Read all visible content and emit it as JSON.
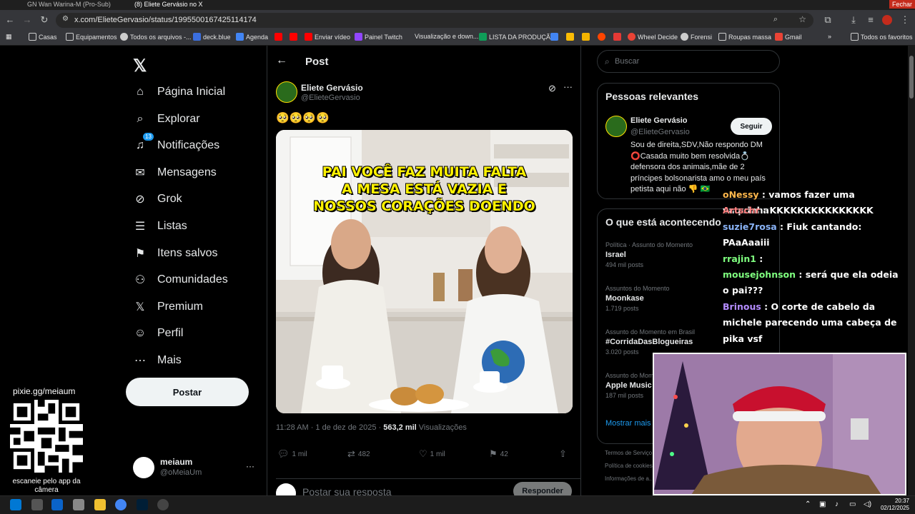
{
  "browser": {
    "tabs": [
      "GN Wan Warina-M (Pro-Sub)",
      "(8) Eliete Gervásio no X"
    ],
    "close_label": "Fechar",
    "url": "x.com/ElieteGervasio/status/1995500167425114174",
    "bookmarks": [
      "Casas",
      "Equipamentos",
      "Todos os arquivos -...",
      "deck.blue",
      "Agenda",
      "Enviar vídeo",
      "Painel Twitch",
      "Visualização e down...",
      "LISTA DA PRODUÇÃ...",
      "Wheel Decide",
      "Forensi",
      "Roupas massa",
      "Gmail",
      "Todos os favoritos"
    ]
  },
  "nav": {
    "items": [
      {
        "label": "Página Inicial",
        "icon": "home-icon"
      },
      {
        "label": "Explorar",
        "icon": "search-icon"
      },
      {
        "label": "Notificações",
        "icon": "bell-icon"
      },
      {
        "label": "Mensagens",
        "icon": "mail-icon"
      },
      {
        "label": "Grok",
        "icon": "grok-icon"
      },
      {
        "label": "Listas",
        "icon": "list-icon"
      },
      {
        "label": "Itens salvos",
        "icon": "bookmark-icon"
      },
      {
        "label": "Comunidades",
        "icon": "people-icon"
      },
      {
        "label": "Premium",
        "icon": "x-logo-icon"
      },
      {
        "label": "Perfil",
        "icon": "person-icon"
      },
      {
        "label": "Mais",
        "icon": "more-circle-icon"
      }
    ],
    "notifications_badge": "13",
    "post_button": "Postar",
    "account": {
      "name": "meiaum",
      "handle": "@oMeiaUm"
    }
  },
  "overlay": {
    "link": "pixie.gg/meiaum",
    "qr_caption": "escaneie pelo app da câmera"
  },
  "post": {
    "header": "Post",
    "author_name": "Eliete Gervásio",
    "author_handle": "@ElieteGervasio",
    "text": "🥺🥺🥺🥺",
    "image_caption_lines": [
      "PAI VOCÊ FAZ MUITA FALTA",
      "A MESA ESTÁ VAZIA E",
      "NOSSOS CORAÇÕES DOENDO"
    ],
    "time": "11:28 AM · 1 de dez de 2025 ·",
    "views_count": "563,2 mil",
    "views_label": "Visualizações",
    "replies": "1 mil",
    "reposts": "482",
    "likes": "1 mil",
    "bookmarks": "42",
    "reply_placeholder": "Postar sua resposta",
    "reply_button": "Responder"
  },
  "sidebar": {
    "search_placeholder": "Buscar",
    "relevant_title": "Pessoas relevantes",
    "relevant_person": {
      "name": "Eliete Gervásio",
      "handle": "@ElieteGervasio",
      "follow": "Seguir",
      "bio": "Sou de direita,SDV,Não respondo DM ⭕Casada muito bem resolvida💍 defensora dos animais,mãe de 2 príncipes bolsonarista amo o meu país petista aqui não 👎 🇧🇷"
    },
    "trends_title": "O que está acontecendo",
    "trends": [
      {
        "context": "Política · Assunto do Momento",
        "name": "Israel",
        "count": "494 mil posts"
      },
      {
        "context": "Assuntos do Momento",
        "name": "Moonkase",
        "count": "1.719 posts"
      },
      {
        "context": "Assunto do Momento em Brasil",
        "name": "#CorridaDasBlogueiras",
        "count": "3.020 posts"
      },
      {
        "context": "Assunto do Momento",
        "name": "Apple Music",
        "count": "187 mil posts"
      }
    ],
    "show_more": "Mostrar mais",
    "footer": [
      "Termos de Serviço",
      "Política de cookies",
      "Informações de a..."
    ]
  },
  "chat": [
    {
      "user": "oNessy",
      "color": "#ffb84d",
      "message": "vamos fazer uma vaquinha"
    },
    {
      "user": "Artschr",
      "color": "#ff8080",
      "message": "KKKKKKKKKKKKKKK"
    },
    {
      "user": "suzie7rosa",
      "color": "#8ab4f8",
      "message": "Fiuk cantando:"
    },
    {
      "user": "",
      "color": "#ffffff",
      "message": "PAaAaaiii"
    },
    {
      "user": "rrajin1",
      "color": "#7fff7f",
      "message": ""
    },
    {
      "user": "mousejohnson",
      "color": "#7fff7f",
      "message": "será que ela odeia"
    },
    {
      "user": "",
      "color": "#ffffff",
      "message": "o pai???"
    },
    {
      "user": "Brinous",
      "color": "#b48cff",
      "message": "O corte de cabelo da"
    },
    {
      "user": "",
      "color": "#ffffff",
      "message": "michele parecendo uma cabeça de"
    },
    {
      "user": "",
      "color": "#ffffff",
      "message": "pika vsf"
    }
  ],
  "taskbar": {
    "time": "20:37",
    "date": "02/12/2025"
  }
}
